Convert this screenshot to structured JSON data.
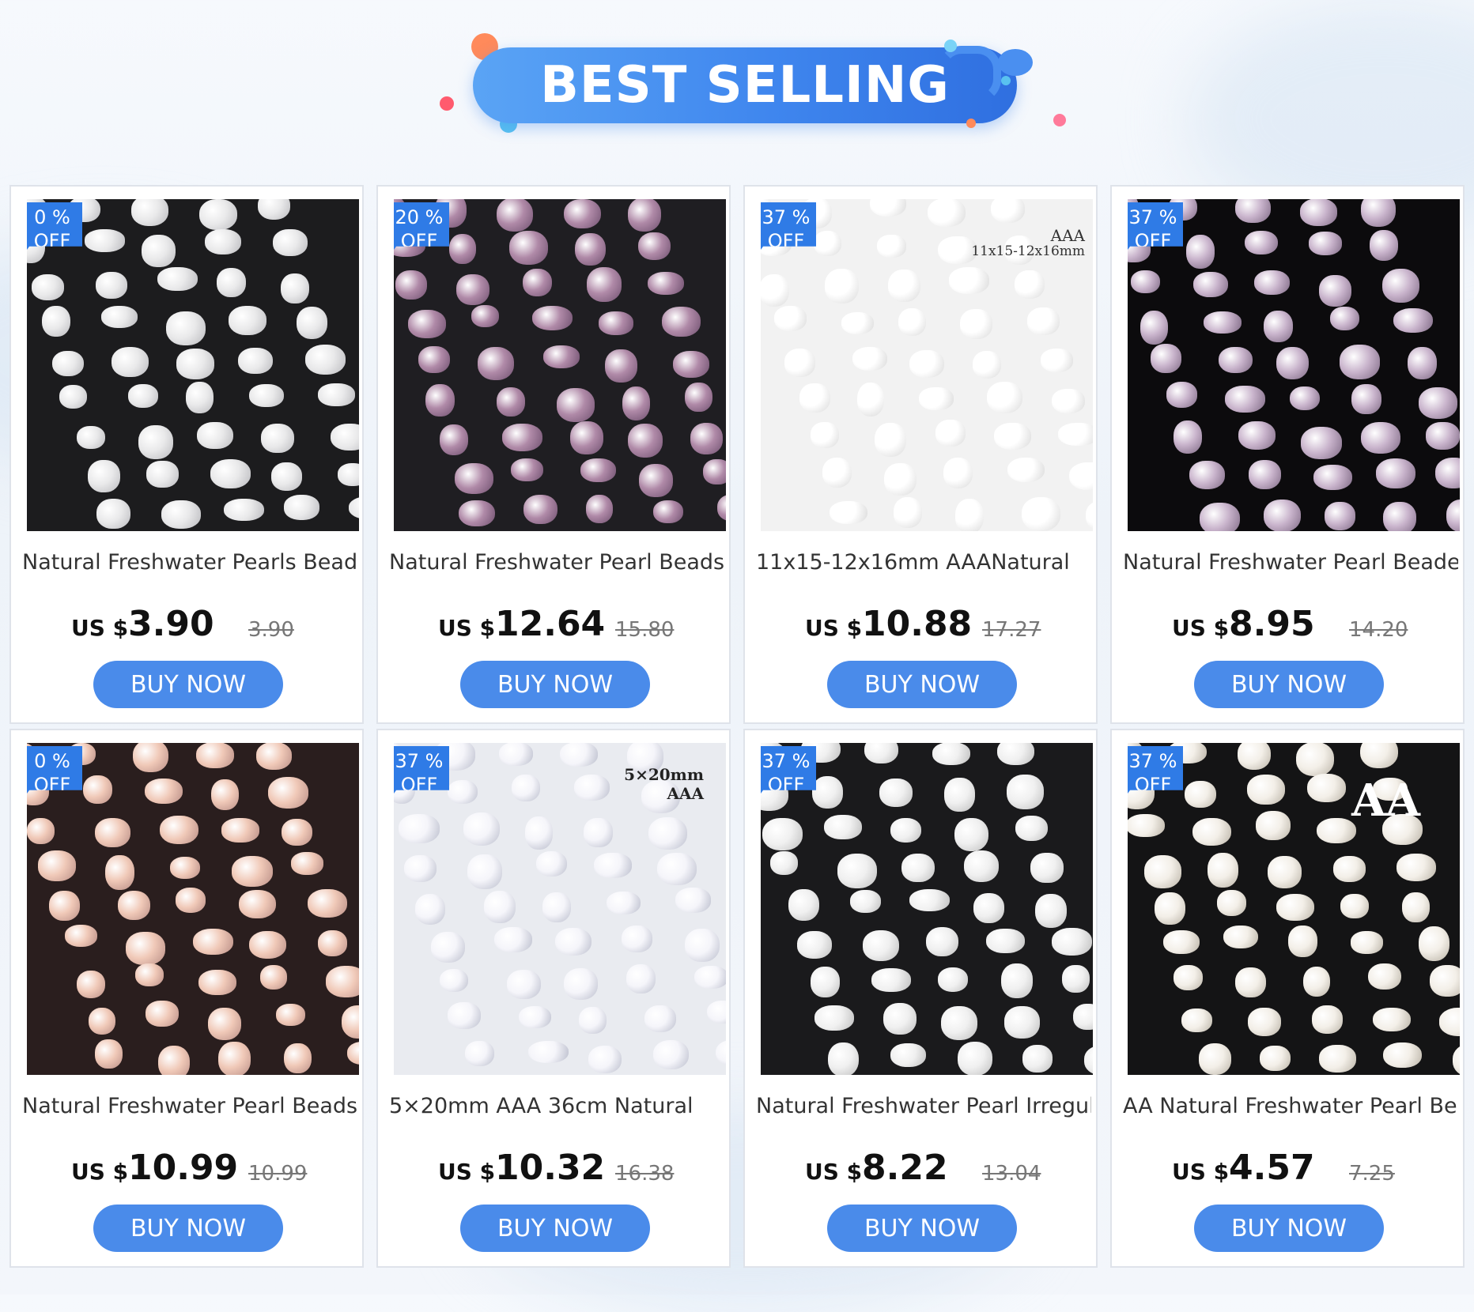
{
  "banner": {
    "title": "BEST SELLING"
  },
  "products": [
    {
      "discount": "0 %",
      "off": "OFF",
      "title": "Natural Freshwater Pearls Beaded",
      "currency": "US $",
      "price": "3.90",
      "old_price": "3.90",
      "button": "BUY NOW"
    },
    {
      "discount": "20 %",
      "off": "OFF",
      "title": "Natural Freshwater Pearl Beads",
      "currency": "US $",
      "price": "12.64",
      "old_price": "15.80",
      "button": "BUY NOW"
    },
    {
      "discount": "37 %",
      "off": "OFF",
      "title": "11x15-12x16mm AAANatural",
      "currency": "US $",
      "price": "10.88",
      "old_price": "17.27",
      "button": "BUY NOW",
      "image_text": [
        "AAA",
        "11x15-12x16mm"
      ]
    },
    {
      "discount": "37 %",
      "off": "OFF",
      "title": "Natural Freshwater Pearl Beaded",
      "currency": "US $",
      "price": "8.95",
      "old_price": "14.20",
      "button": "BUY NOW"
    },
    {
      "discount": "0 %",
      "off": "OFF",
      "title": "Natural Freshwater Pearl Beads",
      "currency": "US $",
      "price": "10.99",
      "old_price": "10.99",
      "button": "BUY NOW"
    },
    {
      "discount": "37 %",
      "off": "OFF",
      "title": "5×20mm AAA 36cm Natural",
      "currency": "US $",
      "price": "10.32",
      "old_price": "16.38",
      "button": "BUY NOW",
      "image_text": [
        "5×20mm",
        "AAA"
      ]
    },
    {
      "discount": "37 %",
      "off": "OFF",
      "title": "Natural Freshwater Pearl Irregular",
      "currency": "US $",
      "price": "8.22",
      "old_price": "13.04",
      "button": "BUY NOW"
    },
    {
      "discount": "37 %",
      "off": "OFF",
      "title": "AA Natural Freshwater Pearl Bead",
      "currency": "US $",
      "price": "4.57",
      "old_price": "7.25",
      "button": "BUY NOW",
      "image_text": [
        "AA"
      ]
    }
  ],
  "colors": {
    "accent": "#4a8bea",
    "badge": "#2f7be6"
  }
}
